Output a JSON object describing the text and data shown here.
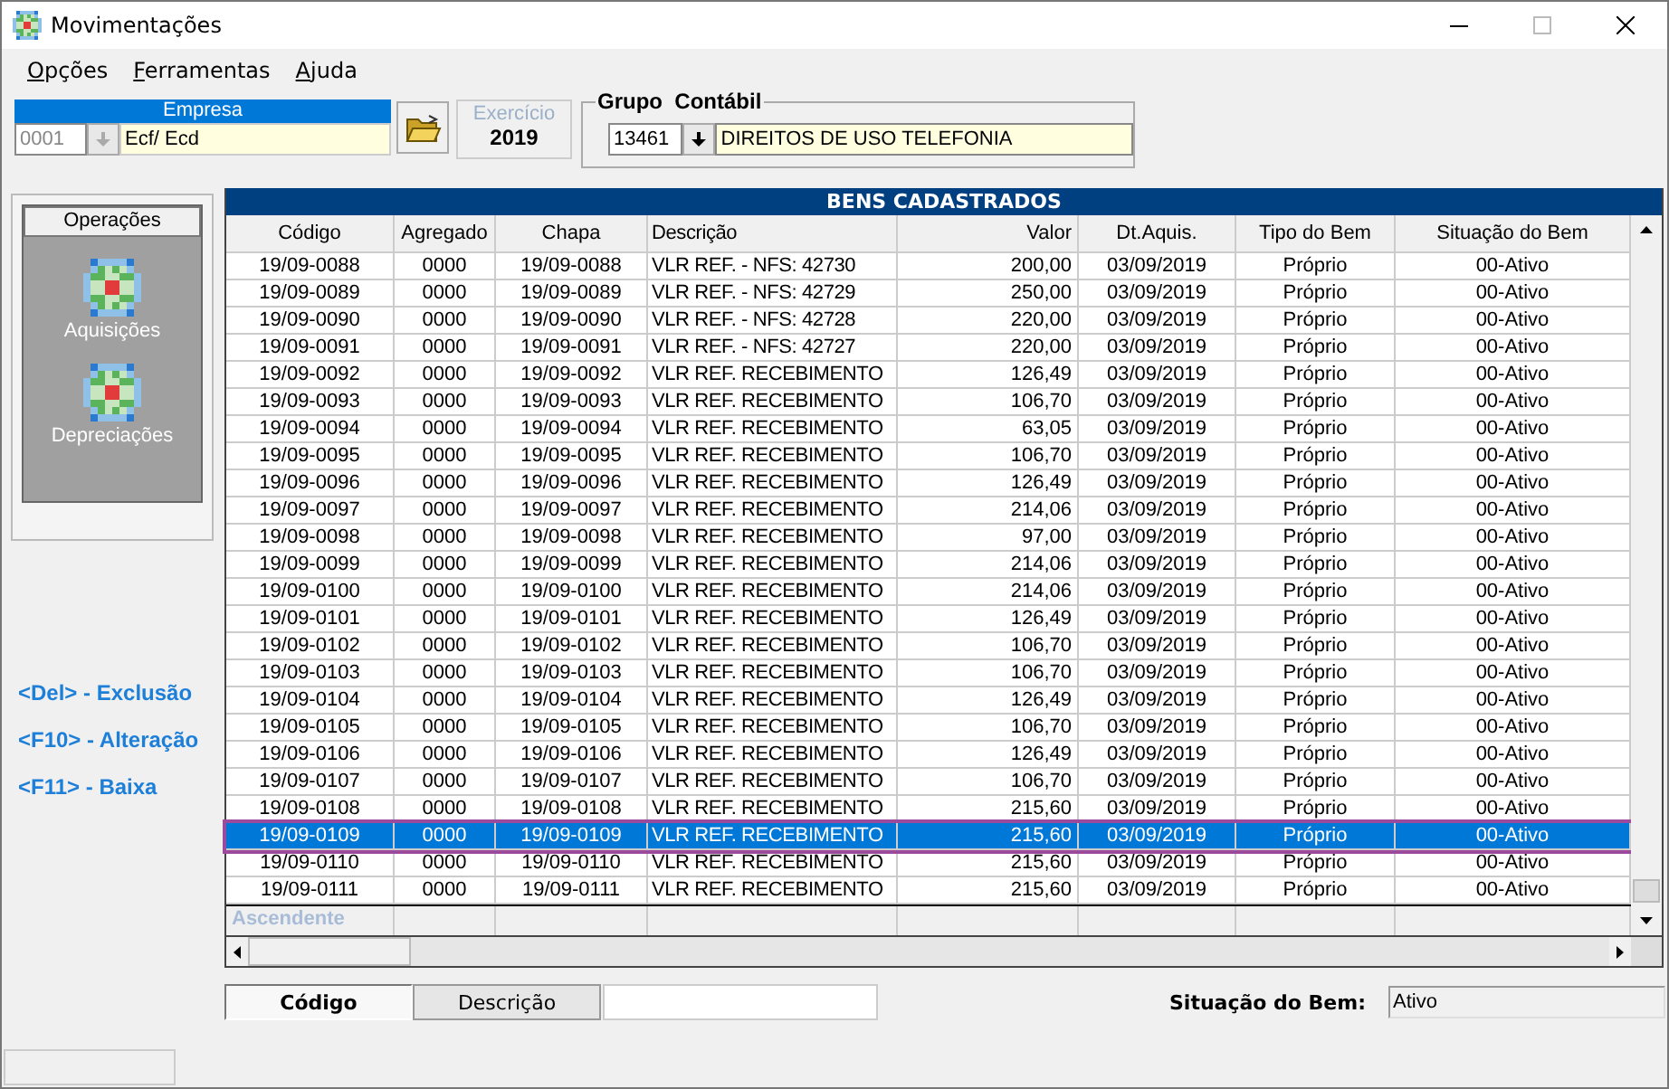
{
  "window": {
    "title": "Movimentações"
  },
  "menu": [
    {
      "label": "Opções"
    },
    {
      "label": "Ferramentas"
    },
    {
      "label": "Ajuda"
    }
  ],
  "empresa": {
    "label": "Empresa",
    "code": "0001",
    "name": "Ecf/ Ecd"
  },
  "exercicio": {
    "label": "Exercício",
    "year": "2019"
  },
  "grupo_contabil": {
    "label": "Grupo  Contábil",
    "code": "13461",
    "name": "DIREITOS DE USO TELEFONIA"
  },
  "operations": {
    "title": "Operações",
    "items": [
      {
        "label": "Aquisições"
      },
      {
        "label": "Depreciações"
      }
    ]
  },
  "shortcuts": [
    "<Del> - Exclusão",
    "<F10> - Alteração",
    "<F11> - Baixa"
  ],
  "table": {
    "title": "BENS CADASTRADOS",
    "columns": [
      "Código",
      "Agregado",
      "Chapa",
      "Descrição",
      "Valor",
      "Dt.Aquis.",
      "Tipo do Bem",
      "Situação do Bem"
    ],
    "rows": [
      {
        "selected": false,
        "cells": [
          "19/09-0088",
          "0000",
          "19/09-0088",
          "VLR REF. - NFS: 42730",
          "200,00",
          "03/09/2019",
          "Próprio",
          "00-Ativo"
        ]
      },
      {
        "selected": false,
        "cells": [
          "19/09-0089",
          "0000",
          "19/09-0089",
          "VLR REF. - NFS: 42729",
          "250,00",
          "03/09/2019",
          "Próprio",
          "00-Ativo"
        ]
      },
      {
        "selected": false,
        "cells": [
          "19/09-0090",
          "0000",
          "19/09-0090",
          "VLR REF. - NFS: 42728",
          "220,00",
          "03/09/2019",
          "Próprio",
          "00-Ativo"
        ]
      },
      {
        "selected": false,
        "cells": [
          "19/09-0091",
          "0000",
          "19/09-0091",
          "VLR REF. - NFS: 42727",
          "220,00",
          "03/09/2019",
          "Próprio",
          "00-Ativo"
        ]
      },
      {
        "selected": false,
        "cells": [
          "19/09-0092",
          "0000",
          "19/09-0092",
          "VLR REF. RECEBIMENTO",
          "126,49",
          "03/09/2019",
          "Próprio",
          "00-Ativo"
        ]
      },
      {
        "selected": false,
        "cells": [
          "19/09-0093",
          "0000",
          "19/09-0093",
          "VLR REF. RECEBIMENTO",
          "106,70",
          "03/09/2019",
          "Próprio",
          "00-Ativo"
        ]
      },
      {
        "selected": false,
        "cells": [
          "19/09-0094",
          "0000",
          "19/09-0094",
          "VLR REF. RECEBIMENTO",
          "63,05",
          "03/09/2019",
          "Próprio",
          "00-Ativo"
        ]
      },
      {
        "selected": false,
        "cells": [
          "19/09-0095",
          "0000",
          "19/09-0095",
          "VLR REF. RECEBIMENTO",
          "106,70",
          "03/09/2019",
          "Próprio",
          "00-Ativo"
        ]
      },
      {
        "selected": false,
        "cells": [
          "19/09-0096",
          "0000",
          "19/09-0096",
          "VLR REF. RECEBIMENTO",
          "126,49",
          "03/09/2019",
          "Próprio",
          "00-Ativo"
        ]
      },
      {
        "selected": false,
        "cells": [
          "19/09-0097",
          "0000",
          "19/09-0097",
          "VLR REF. RECEBIMENTO",
          "214,06",
          "03/09/2019",
          "Próprio",
          "00-Ativo"
        ]
      },
      {
        "selected": false,
        "cells": [
          "19/09-0098",
          "0000",
          "19/09-0098",
          "VLR REF. RECEBIMENTO",
          "97,00",
          "03/09/2019",
          "Próprio",
          "00-Ativo"
        ]
      },
      {
        "selected": false,
        "cells": [
          "19/09-0099",
          "0000",
          "19/09-0099",
          "VLR REF. RECEBIMENTO",
          "214,06",
          "03/09/2019",
          "Próprio",
          "00-Ativo"
        ]
      },
      {
        "selected": false,
        "cells": [
          "19/09-0100",
          "0000",
          "19/09-0100",
          "VLR REF. RECEBIMENTO",
          "214,06",
          "03/09/2019",
          "Próprio",
          "00-Ativo"
        ]
      },
      {
        "selected": false,
        "cells": [
          "19/09-0101",
          "0000",
          "19/09-0101",
          "VLR REF. RECEBIMENTO",
          "126,49",
          "03/09/2019",
          "Próprio",
          "00-Ativo"
        ]
      },
      {
        "selected": false,
        "cells": [
          "19/09-0102",
          "0000",
          "19/09-0102",
          "VLR REF. RECEBIMENTO",
          "106,70",
          "03/09/2019",
          "Próprio",
          "00-Ativo"
        ]
      },
      {
        "selected": false,
        "cells": [
          "19/09-0103",
          "0000",
          "19/09-0103",
          "VLR REF. RECEBIMENTO",
          "106,70",
          "03/09/2019",
          "Próprio",
          "00-Ativo"
        ]
      },
      {
        "selected": false,
        "cells": [
          "19/09-0104",
          "0000",
          "19/09-0104",
          "VLR REF. RECEBIMENTO",
          "126,49",
          "03/09/2019",
          "Próprio",
          "00-Ativo"
        ]
      },
      {
        "selected": false,
        "cells": [
          "19/09-0105",
          "0000",
          "19/09-0105",
          "VLR REF. RECEBIMENTO",
          "106,70",
          "03/09/2019",
          "Próprio",
          "00-Ativo"
        ]
      },
      {
        "selected": false,
        "cells": [
          "19/09-0106",
          "0000",
          "19/09-0106",
          "VLR REF. RECEBIMENTO",
          "126,49",
          "03/09/2019",
          "Próprio",
          "00-Ativo"
        ]
      },
      {
        "selected": false,
        "cells": [
          "19/09-0107",
          "0000",
          "19/09-0107",
          "VLR REF. RECEBIMENTO",
          "106,70",
          "03/09/2019",
          "Próprio",
          "00-Ativo"
        ]
      },
      {
        "selected": false,
        "cells": [
          "19/09-0108",
          "0000",
          "19/09-0108",
          "VLR REF. RECEBIMENTO",
          "215,60",
          "03/09/2019",
          "Próprio",
          "00-Ativo"
        ]
      },
      {
        "selected": true,
        "cells": [
          "19/09-0109",
          "0000",
          "19/09-0109",
          "VLR REF. RECEBIMENTO",
          "215,60",
          "03/09/2019",
          "Próprio",
          "00-Ativo"
        ]
      },
      {
        "selected": false,
        "cells": [
          "19/09-0110",
          "0000",
          "19/09-0110",
          "VLR REF. RECEBIMENTO",
          "215,60",
          "03/09/2019",
          "Próprio",
          "00-Ativo"
        ]
      },
      {
        "selected": false,
        "cells": [
          "19/09-0111",
          "0000",
          "19/09-0111",
          "VLR REF. RECEBIMENTO",
          "215,60",
          "03/09/2019",
          "Próprio",
          "00-Ativo"
        ]
      }
    ],
    "footer": "Ascendente"
  },
  "sort_buttons": [
    {
      "label": "Código",
      "selected": true
    },
    {
      "label": "Descrição",
      "selected": false
    }
  ],
  "status": {
    "label": "Situação do Bem:",
    "value": "Ativo"
  }
}
